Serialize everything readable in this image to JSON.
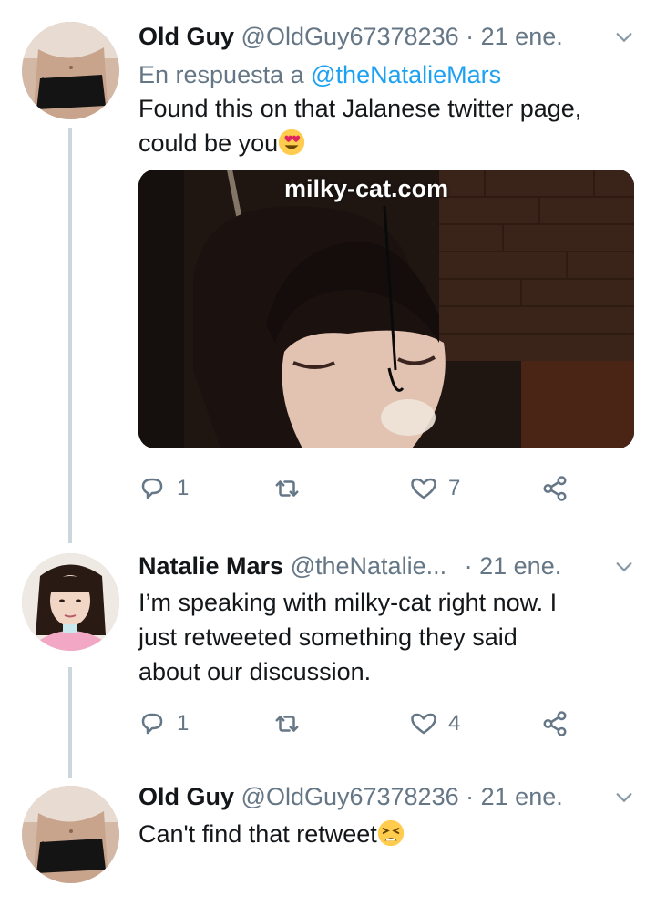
{
  "tweets": [
    {
      "name": "Old Guy",
      "handle": "@OldGuy67378236",
      "dot": "·",
      "time": "21 ene.",
      "reply_prefix": "En respuesta a",
      "reply_mention": "@theNatalieMars",
      "text_line1": "Found this on that Jalanese twitter page,",
      "text_line2": "could be you",
      "emoji": "smiling-face-with-heart-eyes",
      "media_watermark": "milky-cat.com",
      "replies": "1",
      "retweets": "",
      "likes": "7"
    },
    {
      "name": "Natalie Mars",
      "handle": "@theNatalie...",
      "dot": "·",
      "time": "21 ene.",
      "text_line1": "I’m speaking with milky-cat right now. I",
      "text_line2": "just retweeted something they said",
      "text_line3": "about our discussion.",
      "replies": "1",
      "retweets": "",
      "likes": "4"
    },
    {
      "name": "Old Guy",
      "handle": "@OldGuy67378236",
      "dot": "·",
      "time": "21 ene.",
      "text_line1": "Can't find that retweet",
      "emoji": "tired-face"
    }
  ],
  "colors": {
    "text": "#14171a",
    "secondary": "#657786",
    "link": "#1da1f2",
    "thread_line": "#ccd6dd"
  }
}
